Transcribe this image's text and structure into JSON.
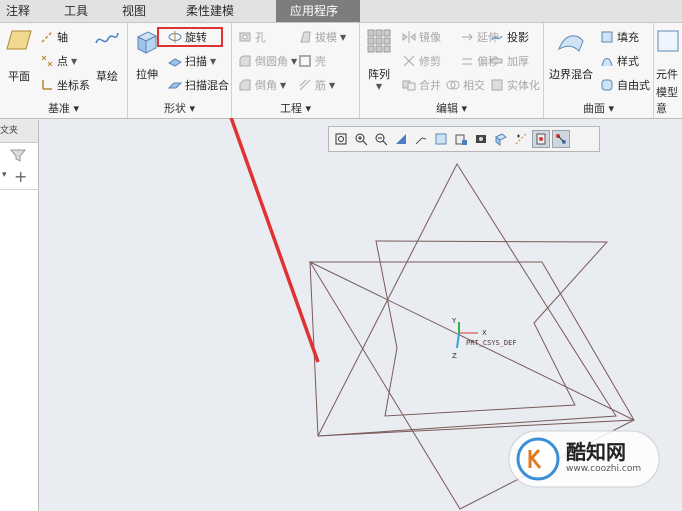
{
  "tabs": [
    "注释",
    "工具",
    "视图",
    "柔性建模",
    "应用程序"
  ],
  "groups": {
    "datum": {
      "label": "基准 ▾",
      "plane": "平面",
      "axis": "轴",
      "point": "点",
      "csys": "坐标系",
      "sketch": "草绘"
    },
    "shapes": {
      "label": "形状 ▾",
      "extrude": "拉伸",
      "revolve": "旋转",
      "sweep": "扫描",
      "swept_blend": "扫描混合"
    },
    "engineering": {
      "label": "工程 ▾",
      "hole": "孔",
      "draft": "拔模",
      "round": "倒圆角",
      "shell": "壳",
      "chamfer": "倒角",
      "rib": "筋"
    },
    "editing": {
      "label": "编辑 ▾",
      "pattern": "阵列",
      "mirror": "镜像",
      "extend": "延伸",
      "project": "投影",
      "trim": "修剪",
      "offset": "偏移",
      "thicken": "加厚",
      "merge": "合并",
      "intersect": "相交",
      "solidify": "实体化"
    },
    "surfaces": {
      "label": "曲面 ▾",
      "boundary_blend": "边界混合",
      "fill": "填充",
      "style": "样式",
      "freeform": "自由式"
    },
    "model_intent": {
      "label": "模型意",
      "element": "元件"
    }
  },
  "left_panel": {
    "header": "文夹"
  },
  "canvas": {
    "csys_label": "PRT_CSYS_DEF",
    "axis_x": "X",
    "axis_y": "Y",
    "axis_z": "Z"
  },
  "watermark": {
    "brand": "酷知网",
    "url": "www.coozhi.com"
  },
  "colors": {
    "highlight": "#e03232",
    "arrow": "#e03232",
    "geometry": "#7a5a5a",
    "active_tab": "#7d7d7d"
  }
}
